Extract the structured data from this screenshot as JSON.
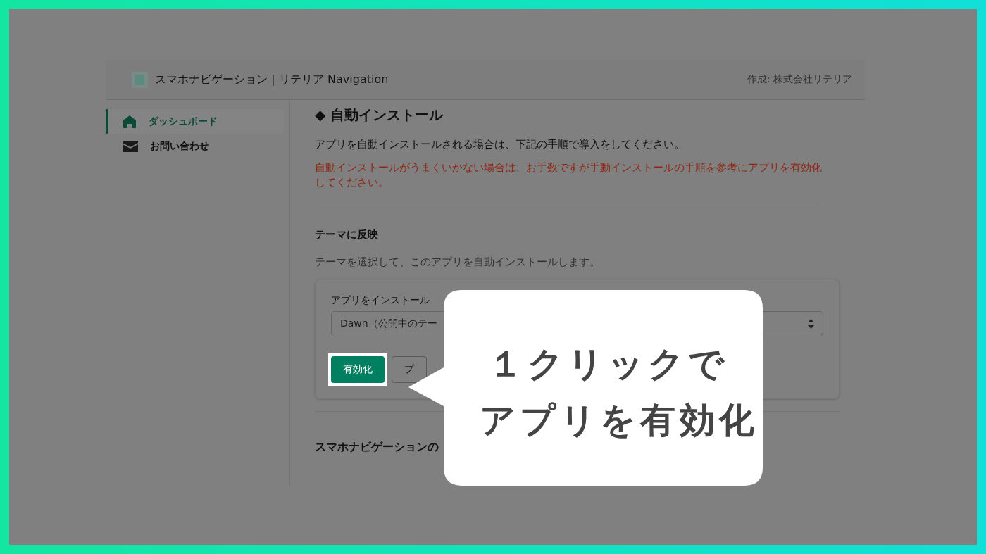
{
  "header": {
    "app_title": "スマホナビゲーション｜リテリア Navigation",
    "author": "作成: 株式会社リテリア"
  },
  "sidebar": {
    "items": [
      {
        "label": "ダッシュボード",
        "kind": "home",
        "selected": true
      },
      {
        "label": "お問い合わせ",
        "kind": "mail",
        "selected": false
      }
    ]
  },
  "content": {
    "heading": "◆ 自動インストール",
    "intro": "アプリを自動インストールされる場合は、下記の手順で導入をしてください。",
    "warning": "自動インストールがうまくいかない場合は、お手数ですが手動インストールの手順を参考にアプリを有効化してください。",
    "section_title": "テーマに反映",
    "section_desc": "テーマを選択して、このアプリを自動インストールします。",
    "theme_select": {
      "label": "アプリをインストール",
      "value": "Dawn（公開中のテー"
    },
    "buttons": [
      {
        "label": "有効化",
        "kind": "primary",
        "highlighted": true
      },
      {
        "label": "プ",
        "kind": "secondary",
        "highlighted": false
      }
    ],
    "next_heading": "スマホナビゲーションの"
  },
  "callout": {
    "lines": [
      "１クリックで",
      "アプリを有効化"
    ]
  }
}
